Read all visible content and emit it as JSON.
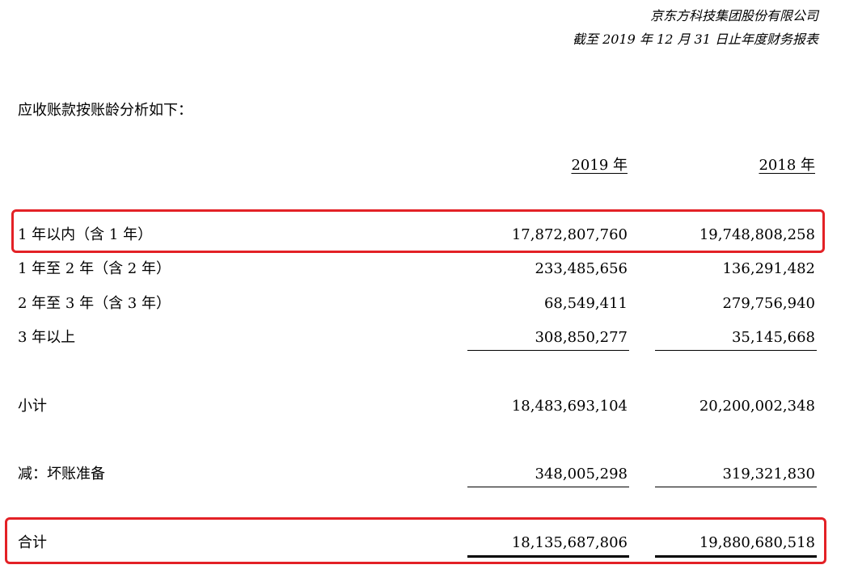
{
  "header": {
    "company": "京东方科技集团股份有限公司",
    "period": "截至 2019 年 12 月 31 日止年度财务报表"
  },
  "intro": "应收账款按账龄分析如下：",
  "columns": [
    "2019 年",
    "2018 年"
  ],
  "rows": [
    {
      "label": "1 年以内（含 1 年）",
      "v2019": "17,872,807,760",
      "v2018": "19,748,808,258",
      "highlighted": true
    },
    {
      "label": "1 年至 2 年（含 2 年）",
      "v2019": "233,485,656",
      "v2018": "136,291,482"
    },
    {
      "label": "2 年至 3 年（含 3 年）",
      "v2019": "68,549,411",
      "v2018": "279,756,940"
    },
    {
      "label": "3 年以上",
      "v2019": "308,850,277",
      "v2018": "35,145,668"
    },
    {
      "label": "小计",
      "v2019": "18,483,693,104",
      "v2018": "20,200,002,348"
    },
    {
      "label": "减：坏账准备",
      "v2019": "348,005,298",
      "v2018": "319,321,830"
    },
    {
      "label": "合计",
      "v2019": "18,135,687,806",
      "v2018": "19,880,680,518",
      "highlighted": true
    }
  ],
  "highlight_color": "#e32126"
}
